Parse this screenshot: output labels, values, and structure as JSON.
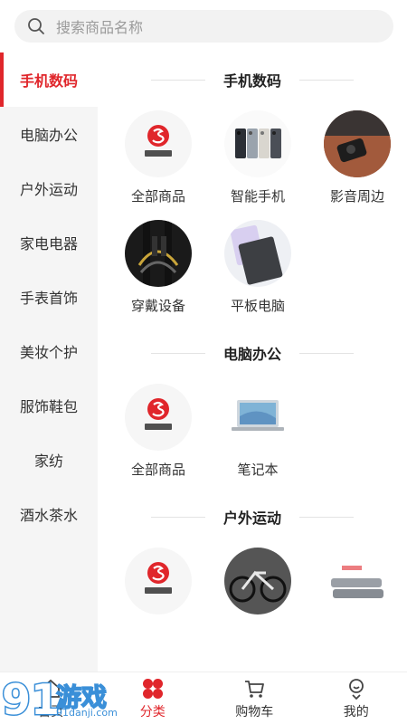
{
  "search": {
    "placeholder": "搜索商品名称"
  },
  "sidebar": {
    "items": [
      {
        "label": "手机数码"
      },
      {
        "label": "电脑办公"
      },
      {
        "label": "户外运动"
      },
      {
        "label": "家电电器"
      },
      {
        "label": "手表首饰"
      },
      {
        "label": "美妆个护"
      },
      {
        "label": "服饰鞋包"
      },
      {
        "label": "家纺"
      },
      {
        "label": "酒水茶水"
      }
    ]
  },
  "sections": [
    {
      "title": "手机数码",
      "items": [
        {
          "label": "全部商品",
          "icon": "brand-logo-icon"
        },
        {
          "label": "智能手机",
          "icon": "smartphones-icon"
        },
        {
          "label": "影音周边",
          "icon": "av-accessory-icon"
        },
        {
          "label": "穿戴设备",
          "icon": "earphones-icon"
        },
        {
          "label": "平板电脑",
          "icon": "tablet-icon"
        }
      ]
    },
    {
      "title": "电脑办公",
      "items": [
        {
          "label": "全部商品",
          "icon": "brand-logo-icon"
        },
        {
          "label": "笔记本",
          "icon": "laptop-icon"
        }
      ]
    },
    {
      "title": "户外运动",
      "items": [
        {
          "label": "",
          "icon": "brand-logo-icon"
        },
        {
          "label": "",
          "icon": "bicycle-icon"
        },
        {
          "label": "",
          "icon": "sports-gear-icon"
        }
      ]
    }
  ],
  "tabbar": {
    "items": [
      {
        "label": "首页",
        "icon": "home-icon"
      },
      {
        "label": "分类",
        "icon": "category-icon"
      },
      {
        "label": "购物车",
        "icon": "cart-icon"
      },
      {
        "label": "我的",
        "icon": "profile-icon"
      }
    ]
  },
  "watermark": {
    "text": "游戏",
    "site": "91danji.com"
  },
  "colors": {
    "accent": "#e0262b",
    "sidebar_bg": "#f5f5f5",
    "search_bg": "#f2f2f2"
  }
}
